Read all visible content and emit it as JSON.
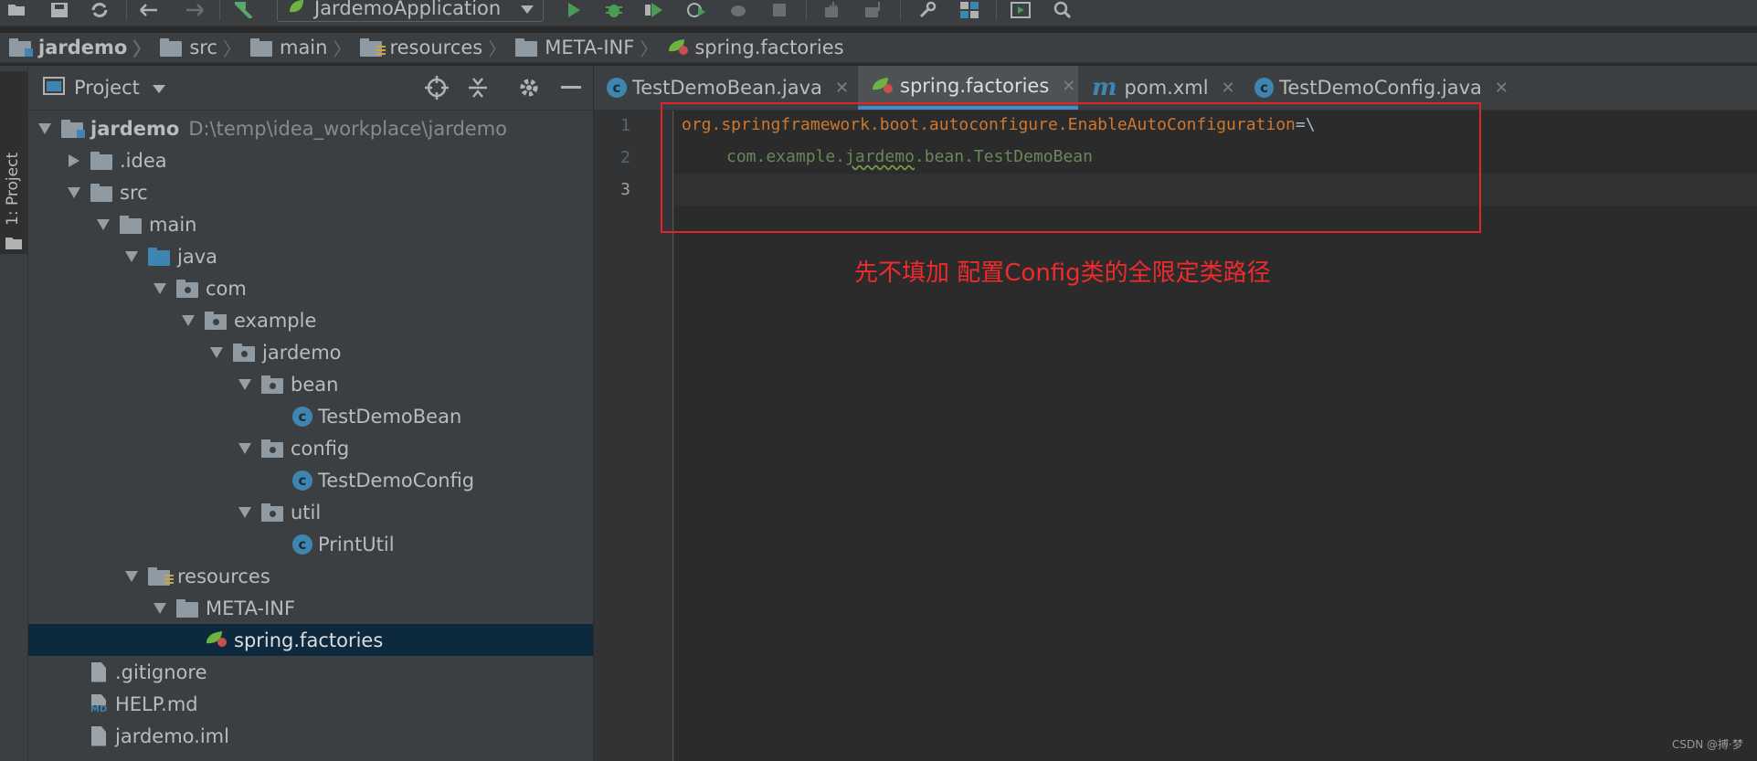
{
  "toolbar": {
    "run_config_label": "JardemoApplication",
    "icons": [
      "open-icon",
      "save-icon",
      "sync-icon",
      "back-icon",
      "forward-icon",
      "build-icon",
      "run-icon",
      "debug-icon",
      "coverage-icon",
      "profile-icon",
      "attach-icon",
      "stop-icon",
      "vcs-update-icon",
      "vcs-commit-icon",
      "settings-wrench-icon",
      "project-structure-icon",
      "run-anything-icon",
      "search-icon"
    ]
  },
  "breadcrumb": [
    "jardemo",
    "src",
    "main",
    "resources",
    "META-INF",
    "spring.factories"
  ],
  "left_strip": {
    "label": "1: Project"
  },
  "project_panel": {
    "title": "Project"
  },
  "tree": [
    {
      "label": "jardemo",
      "hint": "D:\\temp\\idea_workplace\\jardemo"
    },
    {
      "label": ".idea"
    },
    {
      "label": "src"
    },
    {
      "label": "main"
    },
    {
      "label": "java"
    },
    {
      "label": "com"
    },
    {
      "label": "example"
    },
    {
      "label": "jardemo"
    },
    {
      "label": "bean"
    },
    {
      "label": "TestDemoBean"
    },
    {
      "label": "config"
    },
    {
      "label": "TestDemoConfig"
    },
    {
      "label": "util"
    },
    {
      "label": "PrintUtil"
    },
    {
      "label": "resources"
    },
    {
      "label": "META-INF"
    },
    {
      "label": "spring.factories"
    },
    {
      "label": ".gitignore"
    },
    {
      "label": "HELP.md"
    },
    {
      "label": "jardemo.iml"
    }
  ],
  "tabs": [
    {
      "label": "TestDemoBean.java"
    },
    {
      "label": "spring.factories"
    },
    {
      "label": "pom.xml"
    },
    {
      "label": "TestDemoConfig.java"
    }
  ],
  "editor": {
    "line_numbers": [
      "1",
      "2",
      "3"
    ],
    "line1_key": "org.springframework.boot.autoconfigure.EnableAutoConfiguration",
    "line1_op": "=\\",
    "line2_a": "com.example.",
    "line2_b": "jardemo",
    "line2_c": ".bean.TestDemoBean"
  },
  "annotation": {
    "text": "先不填加 配置Config类的全限定类路径",
    "color": "#e0262a"
  },
  "watermark": "CSDN @搏·梦",
  "colors": {
    "selection": "#0d293e",
    "accent_blue": "#4a88c7",
    "keyword_orange": "#cc7832",
    "string_green": "#6a8759"
  }
}
